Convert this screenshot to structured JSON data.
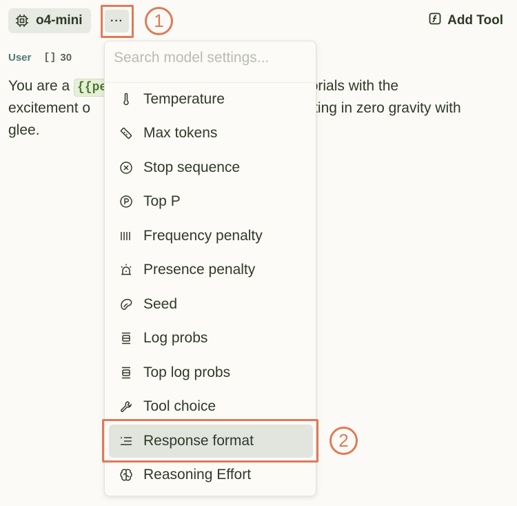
{
  "toolbar": {
    "model_name": "o4-mini",
    "more_label": "···",
    "add_tool_label": "Add Tool"
  },
  "message": {
    "role": "User",
    "token_count": "30",
    "text_before": "You are a ",
    "variable": "{{pe",
    "text_after_line1": "utorials with the",
    "line2_start": "excitement o",
    "line2_end": "ting in zero gravity with",
    "line3": "glee."
  },
  "dropdown": {
    "search_placeholder": "Search model settings...",
    "items": [
      {
        "label": "Temperature",
        "icon": "thermometer-icon"
      },
      {
        "label": "Max tokens",
        "icon": "ruler-icon"
      },
      {
        "label": "Stop sequence",
        "icon": "x-circle-icon"
      },
      {
        "label": "Top P",
        "icon": "p-circle-icon"
      },
      {
        "label": "Frequency penalty",
        "icon": "bars-icon"
      },
      {
        "label": "Presence penalty",
        "icon": "siren-icon"
      },
      {
        "label": "Seed",
        "icon": "bean-icon"
      },
      {
        "label": "Log probs",
        "icon": "layers-icon"
      },
      {
        "label": "Top log probs",
        "icon": "layers-icon"
      },
      {
        "label": "Tool choice",
        "icon": "wrench-icon"
      },
      {
        "label": "Response format",
        "icon": "list-indent-icon"
      },
      {
        "label": "Reasoning Effort",
        "icon": "brain-icon"
      }
    ]
  },
  "callouts": {
    "one": "1",
    "two": "2",
    "color": "#e07a58"
  }
}
